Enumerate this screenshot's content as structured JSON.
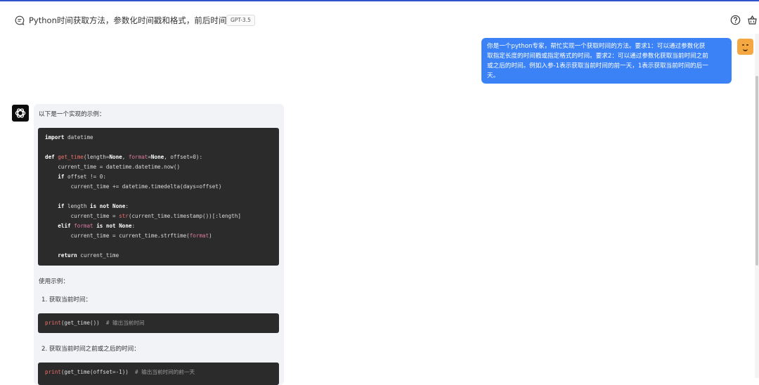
{
  "header": {
    "title": "Python时间获取方法，参数化时间戳和格式，前后时间获取",
    "badge": "GPT-3.5",
    "icons": [
      "chat-icon",
      "help-icon",
      "basket-icon"
    ]
  },
  "user_message": {
    "lines": [
      "你是一个python专家，帮忙实现一个获取时间的方法。要求1：可以通过参数化获",
      "取指定长度的时间戳或指定格式的时间。要求2：可以通过参数化获取当前时间之前",
      "或之后的时间。例如入参-1表示获取当前时间的前一天，1表示获取当前时间的后一",
      "天。"
    ]
  },
  "bot_message": {
    "intro": "以下是一个实现的示例：",
    "code1": [
      "import datetime",
      "",
      "def get_time(length=None, format=None, offset=0):",
      "    current_time = datetime.datetime.now()",
      "    if offset != 0:",
      "        current_time += datetime.timedelta(days=offset)",
      "",
      "    if length is not None:",
      "        current_time = str(current_time.timestamp())[:length]",
      "    elif format is not None:",
      "        current_time = current_time.strftime(format)",
      "",
      "    return current_time"
    ],
    "usage_label": "使用示例：",
    "step1": "1.  获取当前时间：",
    "code2": "print(get_time())  # 输出当前时间",
    "step2": "2.  获取当前时间之前或之后的时间：",
    "code3": "print(get_time(offset=-1))  # 输出当前时间的前一天"
  },
  "colors": {
    "user_bubble": "#3b82f6",
    "bot_bubble": "#f1f3f6",
    "code_bg": "#2b2b2b",
    "accent_line": "#2f54c9"
  }
}
